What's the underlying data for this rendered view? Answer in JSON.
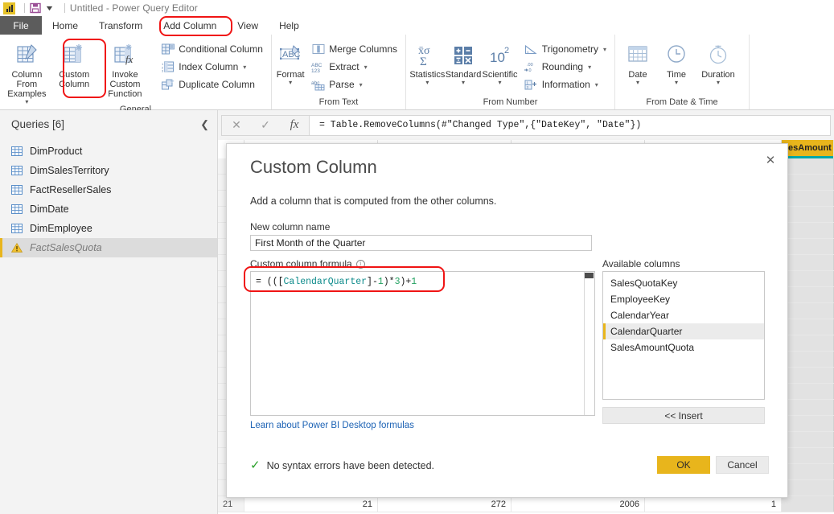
{
  "window": {
    "title": "Untitled - Power Query Editor",
    "logo_icon": "power-bi-logo-icon",
    "save_icon": "save-icon",
    "qat_chevron_icon": "chevron-down-icon"
  },
  "tabs": {
    "file_label": "File",
    "items": [
      {
        "label": "Home",
        "active": false
      },
      {
        "label": "Transform",
        "active": false
      },
      {
        "label": "Add Column",
        "active": true
      },
      {
        "label": "View",
        "active": false
      },
      {
        "label": "Help",
        "active": false
      }
    ]
  },
  "ribbon": {
    "groups": [
      {
        "name": "General",
        "label": "General",
        "big_buttons": [
          {
            "label": "Column From\nExamples",
            "icon": "column-from-examples-icon",
            "caret": true
          },
          {
            "label": "Custom\nColumn",
            "icon": "custom-column-icon",
            "caret": false
          },
          {
            "label": "Invoke Custom\nFunction",
            "icon": "invoke-custom-function-icon",
            "caret": false
          }
        ],
        "small_buttons": [
          {
            "label": "Conditional Column",
            "icon": "conditional-column-icon",
            "caret": false
          },
          {
            "label": "Index Column",
            "icon": "index-column-icon",
            "caret": true
          },
          {
            "label": "Duplicate Column",
            "icon": "duplicate-column-icon",
            "caret": false
          }
        ]
      },
      {
        "name": "From Text",
        "label": "From Text",
        "big_buttons": [
          {
            "label": "Format",
            "icon": "format-abc-icon",
            "caret": true
          }
        ],
        "small_buttons": [
          {
            "label": "Merge Columns",
            "icon": "merge-columns-icon",
            "caret": false
          },
          {
            "label": "Extract",
            "icon": "extract-abc123-icon",
            "caret": true
          },
          {
            "label": "Parse",
            "icon": "parse-abc-icon",
            "caret": true
          }
        ]
      },
      {
        "name": "From Number",
        "label": "From Number",
        "big_buttons": [
          {
            "label": "Statistics",
            "icon": "statistics-sigma-icon",
            "caret": true
          },
          {
            "label": "Standard",
            "icon": "standard-operators-icon",
            "caret": true
          },
          {
            "label": "Scientific",
            "icon": "scientific-power-icon",
            "caret": true
          }
        ],
        "small_buttons": [
          {
            "label": "Trigonometry",
            "icon": "trigonometry-icon",
            "caret": true
          },
          {
            "label": "Rounding",
            "icon": "rounding-icon",
            "caret": true
          },
          {
            "label": "Information",
            "icon": "information-icon",
            "caret": true
          }
        ]
      },
      {
        "name": "From Date & Time",
        "label": "From Date & Time",
        "big_buttons": [
          {
            "label": "Date",
            "icon": "calendar-icon",
            "caret": true
          },
          {
            "label": "Time",
            "icon": "clock-icon",
            "caret": true
          },
          {
            "label": "Duration",
            "icon": "stopwatch-icon",
            "caret": true
          }
        ],
        "small_buttons": []
      }
    ]
  },
  "queries_pane": {
    "title": "Queries [6]",
    "collapse_icon": "chevron-left-icon",
    "items": [
      {
        "label": "DimProduct",
        "icon": "table-icon",
        "selected": false
      },
      {
        "label": "DimSalesTerritory",
        "icon": "table-icon",
        "selected": false
      },
      {
        "label": "FactResellerSales",
        "icon": "table-icon",
        "selected": false
      },
      {
        "label": "DimDate",
        "icon": "table-icon",
        "selected": false
      },
      {
        "label": "DimEmployee",
        "icon": "table-icon",
        "selected": false
      },
      {
        "label": "FactSalesQuota",
        "icon": "warning-icon",
        "selected": true
      }
    ]
  },
  "formula_bar": {
    "cancel_icon": "close-icon",
    "accept_icon": "check-icon",
    "fx_icon": "fx-icon",
    "value": "= Table.RemoveColumns(#\"Changed Type\",{\"DateKey\", \"Date\"})"
  },
  "grid": {
    "headers": [
      "",
      "",
      "",
      "",
      "lesAmount"
    ],
    "highlight_header_index": 4,
    "last_row": {
      "index": "21",
      "cells": [
        "21",
        "272",
        "2006",
        "1"
      ]
    }
  },
  "dialog": {
    "title": "Custom Column",
    "close_icon": "close-icon",
    "subtitle": "Add a column that is computed from the other columns.",
    "new_column_name_label": "New column name",
    "new_column_name_value": "First Month of the Quarter",
    "new_column_name_placeholder": "New column name",
    "formula_label": "Custom column formula",
    "formula_info_icon": "info-icon",
    "formula_tokens": [
      {
        "text": "= (([",
        "kind": "op"
      },
      {
        "text": "CalendarQuarter",
        "kind": "col"
      },
      {
        "text": "]-",
        "kind": "op"
      },
      {
        "text": "1",
        "kind": "num"
      },
      {
        "text": ")*",
        "kind": "op"
      },
      {
        "text": "3",
        "kind": "num"
      },
      {
        "text": ")+",
        "kind": "op"
      },
      {
        "text": "1",
        "kind": "num"
      }
    ],
    "formula_plain": "= (([CalendarQuarter]-1)*3)+1",
    "learn_link": "Learn about Power BI Desktop formulas",
    "available_columns_label": "Available columns",
    "available_columns": [
      {
        "label": "SalesQuotaKey",
        "selected": false
      },
      {
        "label": "EmployeeKey",
        "selected": false
      },
      {
        "label": "CalendarYear",
        "selected": false
      },
      {
        "label": "CalendarQuarter",
        "selected": true
      },
      {
        "label": "SalesAmountQuota",
        "selected": false
      }
    ],
    "insert_label": "<< Insert",
    "status_icon": "check-icon",
    "status_text": "No syntax errors have been detected.",
    "ok_label": "OK",
    "cancel_label": "Cancel"
  },
  "annotations": [
    {
      "name": "annotation-add-column",
      "color": "#f01414"
    },
    {
      "name": "annotation-custom-column",
      "color": "#f01414"
    },
    {
      "name": "annotation-formula",
      "color": "#f01414"
    }
  ],
  "colors": {
    "accent_yellow": "#e8b51c",
    "teal": "#00a7a7",
    "annotation_red": "#f01414",
    "file_tab_gray": "#5c5c5c",
    "link_blue": "#1d63b5",
    "success_green": "#2aa02a"
  }
}
